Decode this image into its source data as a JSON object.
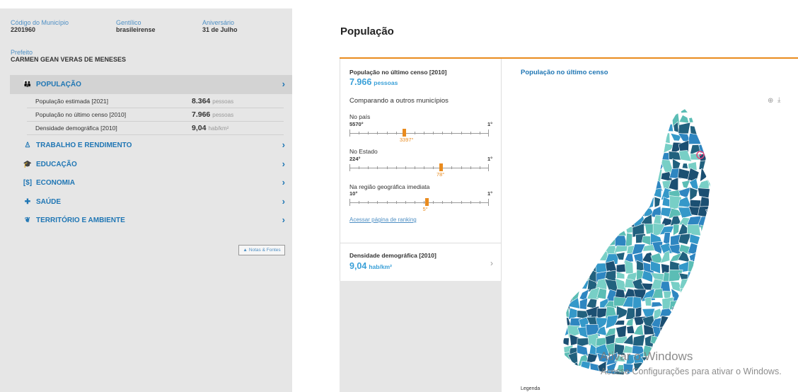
{
  "municipio": {
    "codigo_label": "Código do Município",
    "codigo_value": "2201960",
    "gentilico_label": "Gentílico",
    "gentilico_value": "brasileirense",
    "aniversario_label": "Aniversário",
    "aniversario_value": "31 de Julho",
    "prefeito_label": "Prefeito",
    "prefeito_value": "CARMEN GEAN VERAS DE MENESES"
  },
  "sections": [
    {
      "label": "POPULAÇÃO",
      "icon": "people-icon",
      "glyph": "👪"
    },
    {
      "label": "TRABALHO E RENDIMENTO",
      "icon": "worker-icon",
      "glyph": "♙"
    },
    {
      "label": "EDUCAÇÃO",
      "icon": "graduation-cap-icon",
      "glyph": "🎓"
    },
    {
      "label": "ECONOMIA",
      "icon": "money-icon",
      "glyph": "[$]"
    },
    {
      "label": "SAÚDE",
      "icon": "medical-kit-icon",
      "glyph": "✚"
    },
    {
      "label": "TERRITÓRIO E AMBIENTE",
      "icon": "leaf-icon",
      "glyph": "❦"
    }
  ],
  "population_rows": [
    {
      "label": "População estimada [2021]",
      "value": "8.364",
      "unit": "pessoas"
    },
    {
      "label": "População no último censo [2010]",
      "value": "7.966",
      "unit": "pessoas"
    },
    {
      "label": "Densidade demográfica [2010]",
      "value": "9,04",
      "unit": "hab/km²"
    }
  ],
  "notes_button": "Notas & Fontes",
  "heading": "População",
  "censo": {
    "title": "População no último censo [2010]",
    "value": "7.966",
    "unit": "pessoas",
    "compare": "Comparando a outros municípios"
  },
  "rankings": [
    {
      "label": "No país",
      "left": "5570°",
      "right": "1°",
      "pos_label": "3397°",
      "rank": 3397,
      "total": 5570
    },
    {
      "label": "No Estado",
      "left": "224°",
      "right": "1°",
      "pos_label": "78°",
      "rank": 78,
      "total": 224
    },
    {
      "label": "Na região geográfica imediata",
      "left": "10°",
      "right": "1°",
      "pos_label": "5°",
      "rank": 5,
      "total": 10
    }
  ],
  "ranking_link": "Acessar página de ranking",
  "densidade": {
    "title": "Densidade demográfica [2010]",
    "value": "9,04",
    "unit": "hab/km²"
  },
  "map": {
    "title": "População no último censo",
    "legend": "Legenda"
  },
  "watermark": {
    "line1": "Ativar o Windows",
    "line2": "Acesse Configurações para ativar o Windows."
  },
  "colors": {
    "accent": "#e98b1e",
    "blue": "#1f76b4",
    "map_dark": "#21617e",
    "map_mid": "#2e86c1",
    "map_light": "#5bbdb5"
  }
}
